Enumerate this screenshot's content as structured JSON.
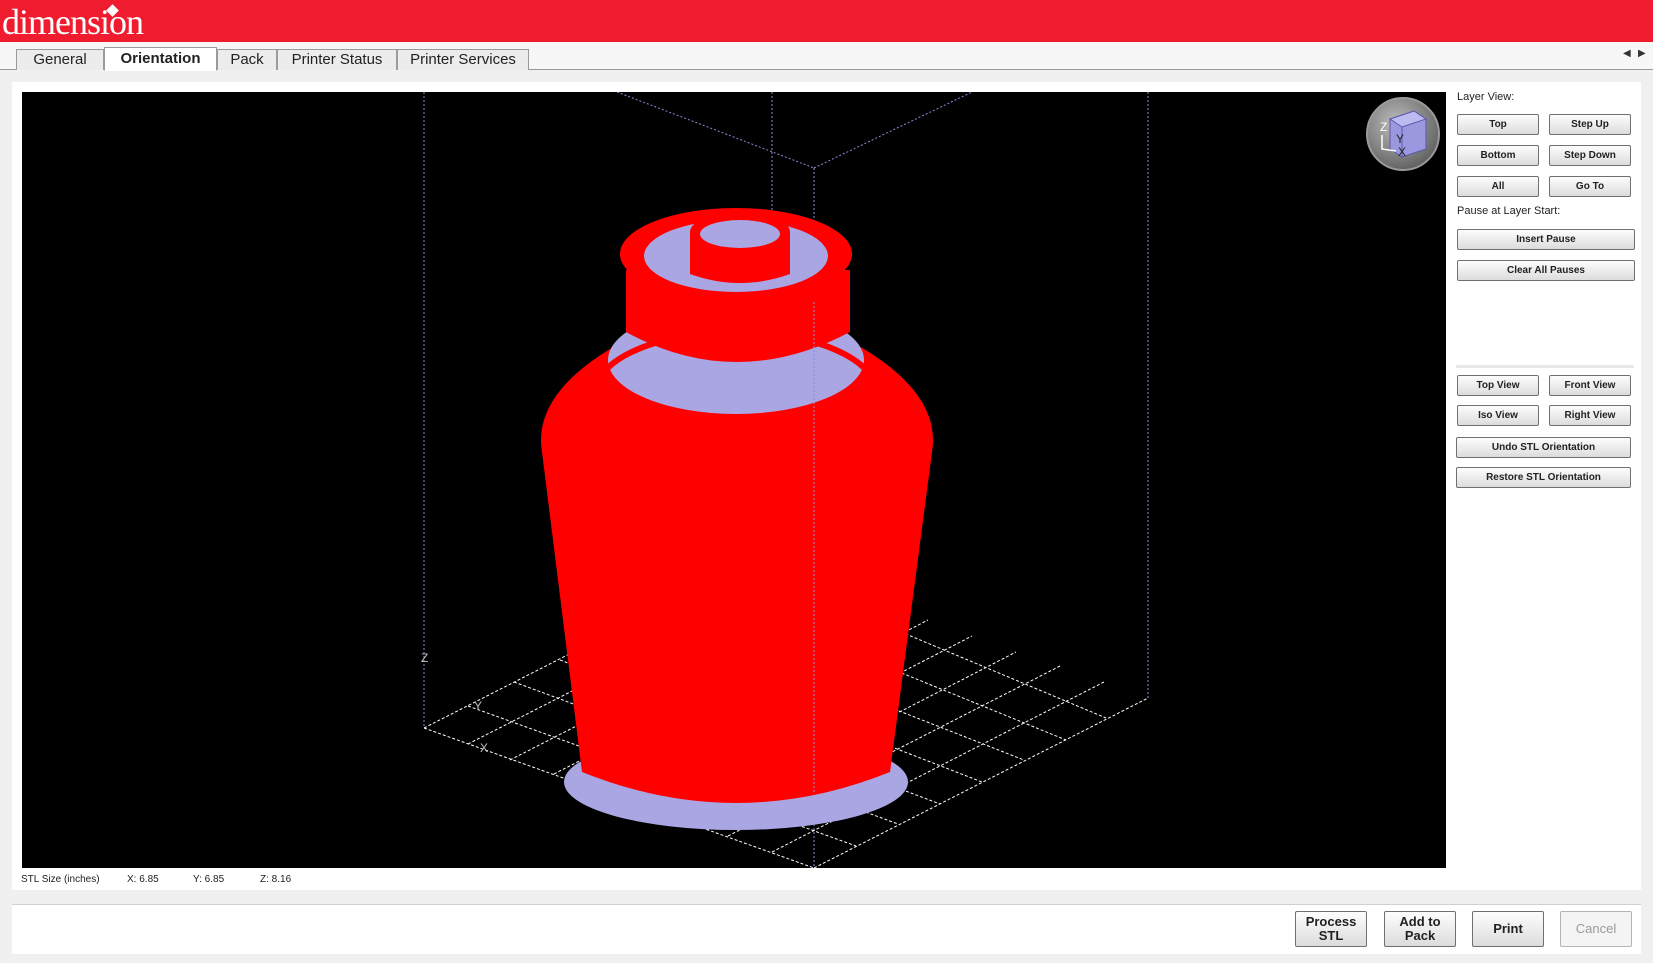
{
  "app": {
    "logo_text": "dimension"
  },
  "tabs": [
    {
      "label": "General",
      "active": false
    },
    {
      "label": "Orientation",
      "active": true
    },
    {
      "label": "Pack",
      "active": false
    },
    {
      "label": "Printer Status",
      "active": false
    },
    {
      "label": "Printer Services",
      "active": false
    }
  ],
  "viewport": {
    "axis_labels": {
      "z": "Z",
      "y": "Y",
      "x": "X"
    },
    "cube_labels": {
      "z": "Z",
      "y": "Y",
      "x": "X"
    },
    "model_color": "#ff0000",
    "highlight_color": "#a9a6e3",
    "grid_color": "#ffffff",
    "background": "#000000"
  },
  "layer_view": {
    "label": "Layer View:",
    "top": "Top",
    "step_up": "Step Up",
    "bottom": "Bottom",
    "step_down": "Step Down",
    "all": "All",
    "go_to": "Go To"
  },
  "pause": {
    "label": "Pause at Layer Start:",
    "insert": "Insert Pause",
    "clear": "Clear All Pauses"
  },
  "views": {
    "top_view": "Top View",
    "front_view": "Front View",
    "iso_view": "Iso View",
    "right_view": "Right View",
    "undo": "Undo STL Orientation",
    "restore": "Restore STL Orientation"
  },
  "stl_size": {
    "label": "STL Size (inches)",
    "x": "X:  6.85",
    "y": "Y:  6.85",
    "z": "Z:  8.16"
  },
  "actions": {
    "process_stl": "Process STL",
    "add_to_pack": "Add to Pack",
    "print": "Print",
    "cancel": "Cancel"
  },
  "colors": {
    "header_red": "#ee1c2e"
  }
}
